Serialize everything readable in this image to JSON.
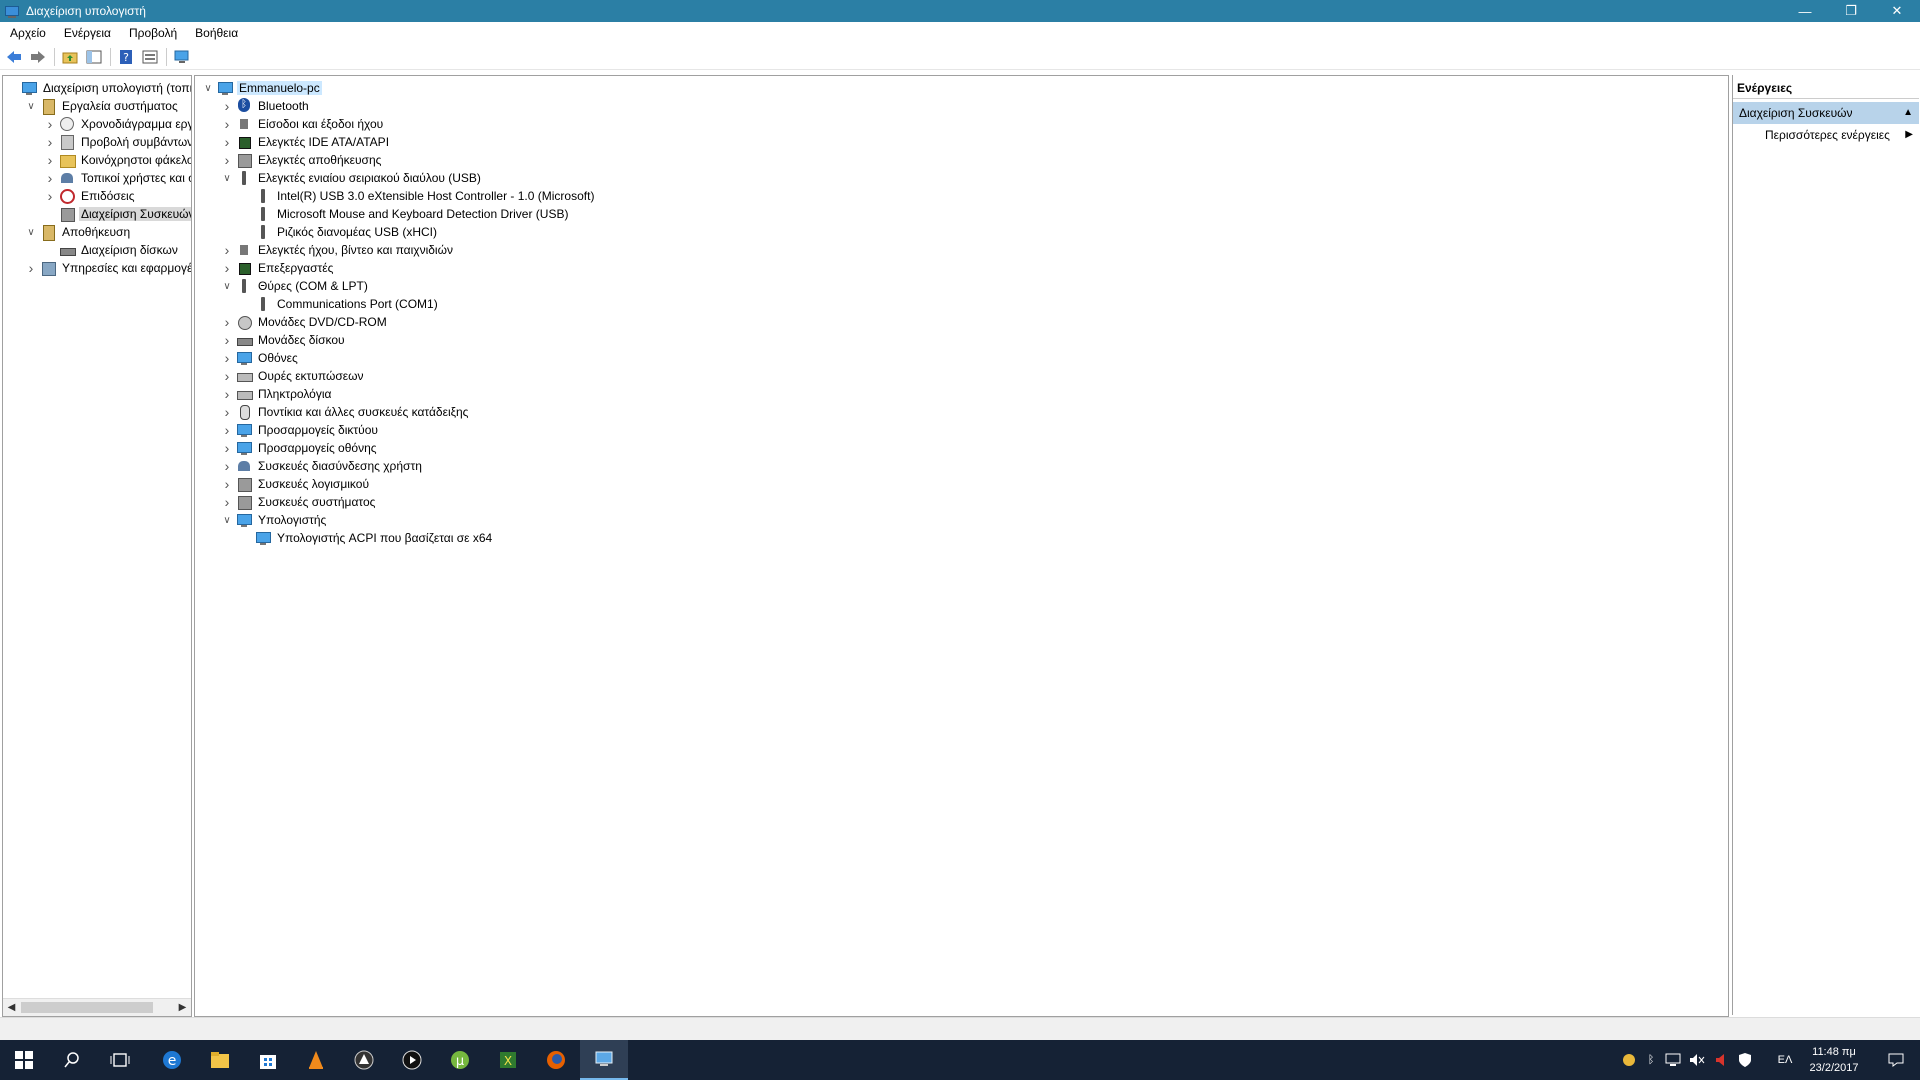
{
  "window": {
    "title": "Διαχείριση υπολογιστή",
    "minimize": "—",
    "restore": "❐",
    "close": "✕"
  },
  "menu": [
    "Αρχείο",
    "Ενέργεια",
    "Προβολή",
    "Βοήθεια"
  ],
  "left_tree": [
    {
      "label": "Διαχείριση υπολογιστή (τοπικός)",
      "level": 0,
      "expander": "",
      "icon": "computer-management-icon"
    },
    {
      "label": "Εργαλεία συστήματος",
      "level": 1,
      "expander": "open",
      "icon": "system-tools-icon"
    },
    {
      "label": "Χρονοδιάγραμμα εργασιών",
      "level": 2,
      "expander": "closed",
      "icon": "task-scheduler-icon"
    },
    {
      "label": "Προβολή συμβάντων",
      "level": 2,
      "expander": "closed",
      "icon": "event-viewer-icon"
    },
    {
      "label": "Κοινόχρηστοι φάκελοι",
      "level": 2,
      "expander": "closed",
      "icon": "shared-folders-icon"
    },
    {
      "label": "Τοπικοί χρήστες και ομάδες",
      "level": 2,
      "expander": "closed",
      "icon": "local-users-icon"
    },
    {
      "label": "Επιδόσεις",
      "level": 2,
      "expander": "closed",
      "icon": "performance-icon"
    },
    {
      "label": "Διαχείριση Συσκευών",
      "level": 2,
      "expander": "",
      "icon": "device-manager-icon",
      "selected": true
    },
    {
      "label": "Αποθήκευση",
      "level": 1,
      "expander": "open",
      "icon": "storage-icon"
    },
    {
      "label": "Διαχείριση δίσκων",
      "level": 2,
      "expander": "",
      "icon": "disk-management-icon"
    },
    {
      "label": "Υπηρεσίες και εφαρμογές",
      "level": 1,
      "expander": "closed",
      "icon": "services-icon"
    }
  ],
  "device_tree": [
    {
      "label": "Emmanuelo-pc",
      "level": 0,
      "expander": "open",
      "icon": "computer-icon",
      "selected": true
    },
    {
      "label": "Bluetooth",
      "level": 1,
      "expander": "closed",
      "icon": "bluetooth-icon"
    },
    {
      "label": "Είσοδοι και έξοδοι ήχου",
      "level": 1,
      "expander": "closed",
      "icon": "audio-io-icon"
    },
    {
      "label": "Ελεγκτές IDE ATA/ATAPI",
      "level": 1,
      "expander": "closed",
      "icon": "ide-controller-icon"
    },
    {
      "label": "Ελεγκτές αποθήκευσης",
      "level": 1,
      "expander": "closed",
      "icon": "storage-controller-icon"
    },
    {
      "label": "Ελεγκτές ενιαίου σειριακού διαύλου (USB)",
      "level": 1,
      "expander": "open",
      "icon": "usb-icon"
    },
    {
      "label": "Intel(R) USB 3.0 eXtensible Host Controller - 1.0 (Microsoft)",
      "level": 2,
      "expander": "",
      "icon": "usb-device-icon"
    },
    {
      "label": "Microsoft Mouse and Keyboard Detection Driver (USB)",
      "level": 2,
      "expander": "",
      "icon": "usb-device-icon"
    },
    {
      "label": "Ριζικός διανομέας USB (xHCI)",
      "level": 2,
      "expander": "",
      "icon": "usb-device-icon"
    },
    {
      "label": "Ελεγκτές ήχου, βίντεο και παιχνιδιών",
      "level": 1,
      "expander": "closed",
      "icon": "sound-controller-icon"
    },
    {
      "label": "Επεξεργαστές",
      "level": 1,
      "expander": "closed",
      "icon": "processor-icon"
    },
    {
      "label": "Θύρες (COM & LPT)",
      "level": 1,
      "expander": "open",
      "icon": "port-icon"
    },
    {
      "label": "Communications Port (COM1)",
      "level": 2,
      "expander": "",
      "icon": "port-device-icon"
    },
    {
      "label": "Μονάδες DVD/CD-ROM",
      "level": 1,
      "expander": "closed",
      "icon": "dvd-icon"
    },
    {
      "label": "Μονάδες δίσκου",
      "level": 1,
      "expander": "closed",
      "icon": "disk-drive-icon"
    },
    {
      "label": "Οθόνες",
      "level": 1,
      "expander": "closed",
      "icon": "monitor-icon"
    },
    {
      "label": "Ουρές εκτυπώσεων",
      "level": 1,
      "expander": "closed",
      "icon": "print-queue-icon"
    },
    {
      "label": "Πληκτρολόγια",
      "level": 1,
      "expander": "closed",
      "icon": "keyboard-icon"
    },
    {
      "label": "Ποντίκια και άλλες συσκευές κατάδειξης",
      "level": 1,
      "expander": "closed",
      "icon": "mouse-icon"
    },
    {
      "label": "Προσαρμογείς δικτύου",
      "level": 1,
      "expander": "closed",
      "icon": "network-adapter-icon"
    },
    {
      "label": "Προσαρμογείς οθόνης",
      "level": 1,
      "expander": "closed",
      "icon": "display-adapter-icon"
    },
    {
      "label": "Συσκευές διασύνδεσης χρήστη",
      "level": 1,
      "expander": "closed",
      "icon": "hid-icon"
    },
    {
      "label": "Συσκευές λογισμικού",
      "level": 1,
      "expander": "closed",
      "icon": "software-device-icon"
    },
    {
      "label": "Συσκευές συστήματος",
      "level": 1,
      "expander": "closed",
      "icon": "system-device-icon"
    },
    {
      "label": "Υπολογιστής",
      "level": 1,
      "expander": "open",
      "icon": "computer-category-icon"
    },
    {
      "label": "Υπολογιστής ACPI που βασίζεται σε x64",
      "level": 2,
      "expander": "",
      "icon": "acpi-computer-icon"
    }
  ],
  "actions": {
    "header": "Ενέργειες",
    "section": "Διαχείριση Συσκευών",
    "more": "Περισσότερες ενέργειες"
  },
  "taskbar": {
    "apps": [
      "start-icon",
      "search-icon",
      "task-view-icon",
      "edge-icon",
      "file-explorer-icon",
      "store-icon",
      "vlc-icon",
      "inkscape-icon",
      "media-player-icon",
      "utorrent-icon",
      "xbox-icon",
      "firefox-icon",
      "computer-management-app-icon"
    ],
    "language": "ΕΛ",
    "time": "11:48 πμ",
    "date": "23/2/2017"
  },
  "colors": {
    "titlebar": "#2b7fa5",
    "taskbar": "#152235",
    "selection": "#cce8ff",
    "actions_section": "#b8d3ea"
  }
}
